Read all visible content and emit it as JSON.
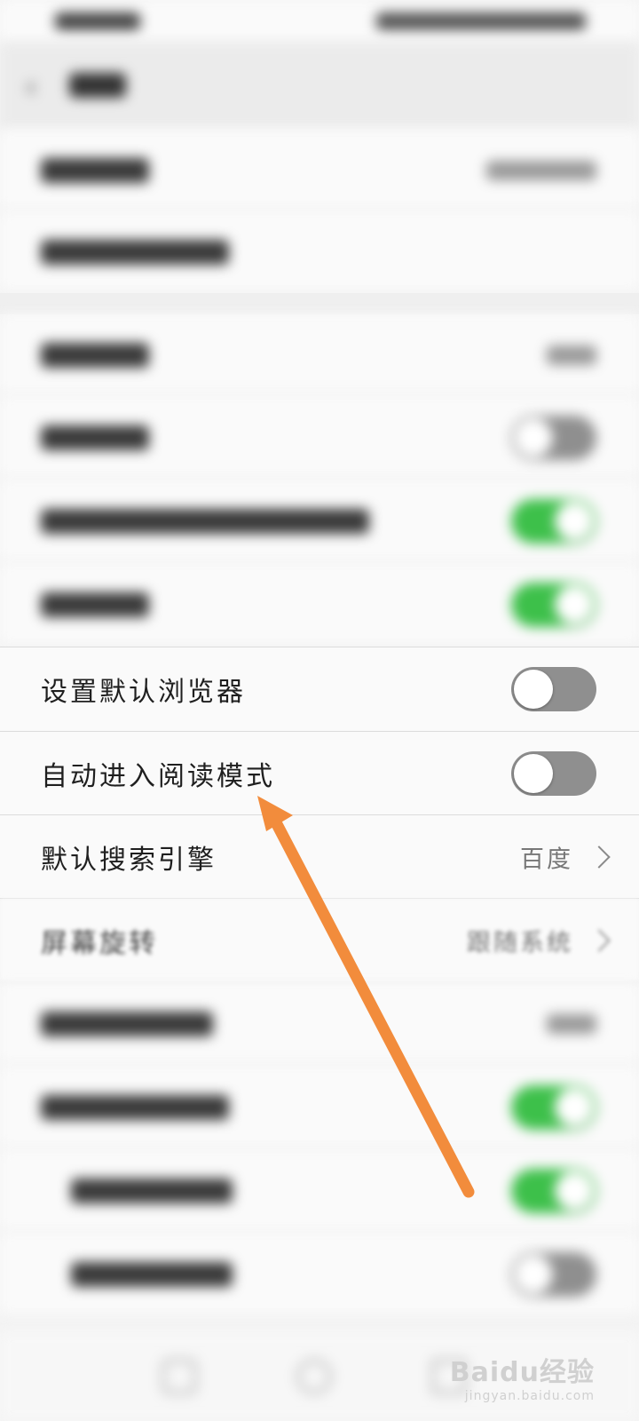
{
  "settings": {
    "default_browser_label": "设置默认浏览器",
    "reading_mode_label": "自动进入阅读模式",
    "search_engine_label": "默认搜索引擎",
    "search_engine_value": "百度",
    "screen_rotation_label": "屏幕旋转",
    "screen_rotation_value": "跟随系统"
  },
  "colors": {
    "toggle_on": "#3dc04a",
    "toggle_off": "#8f8f8f",
    "annotation_arrow": "#f28c3c"
  },
  "icons": {
    "back": "chevron-left-icon",
    "row_chevron": "chevron-right-icon"
  },
  "watermark": {
    "main": "Baidu经验",
    "sub": "jingyan.baidu.com"
  }
}
